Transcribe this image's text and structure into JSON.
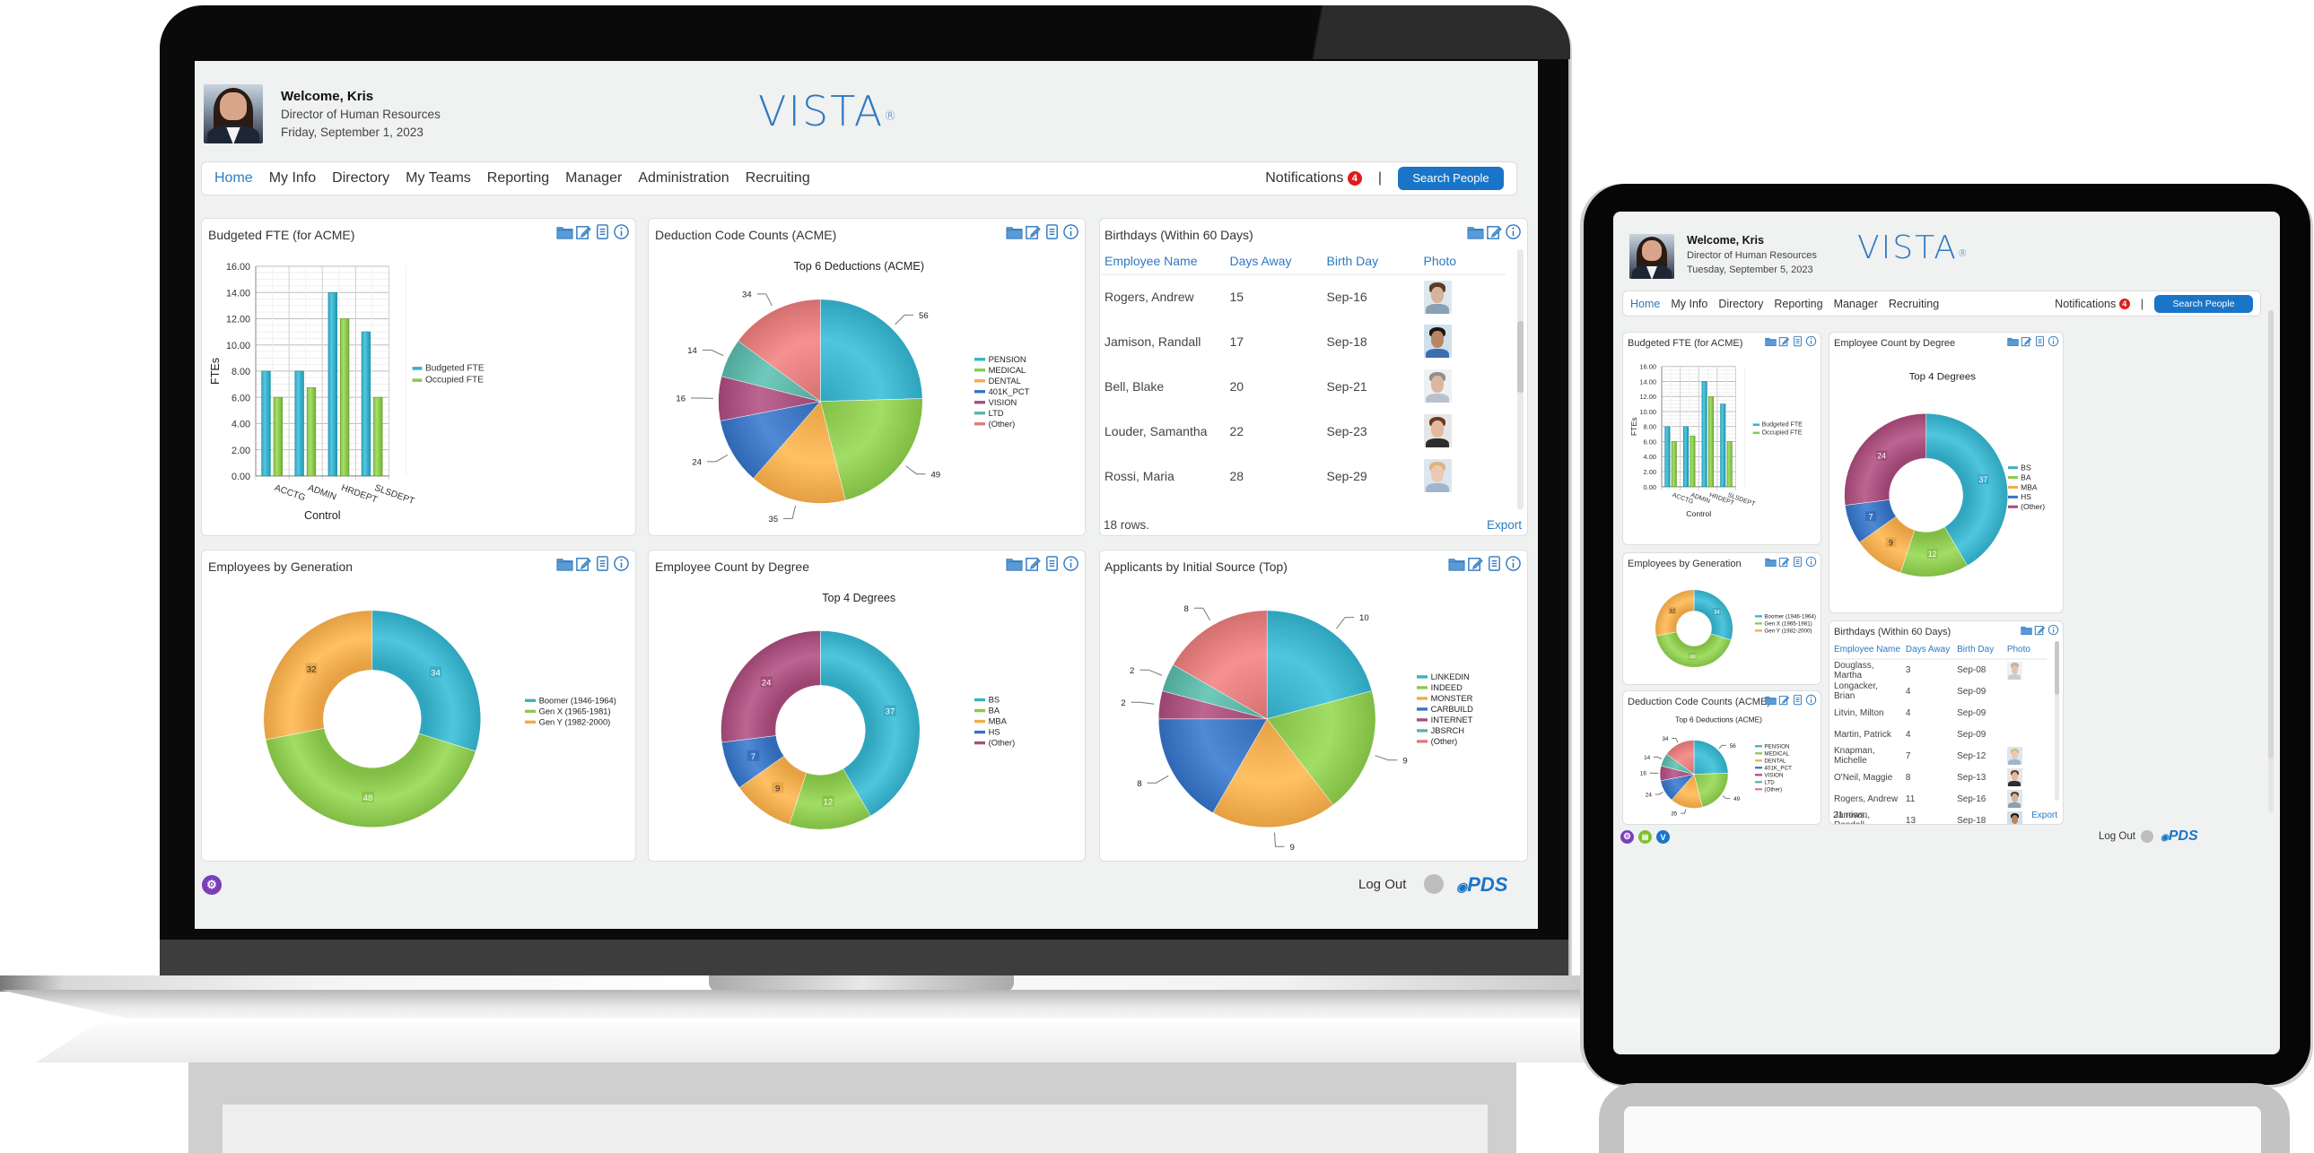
{
  "brand": {
    "logo": "VISTA",
    "registered": "®",
    "vendor_logo": "PDS",
    "accent": "#2f79c1",
    "button_blue": "#1a75c9"
  },
  "palette": {
    "teal": "#3ab0c8",
    "green": "#8cc850",
    "orange": "#f0ab4e",
    "blue": "#3a73c0",
    "plum": "#a64f7c",
    "seafoam": "#5bb3a5",
    "salmon": "#e07b7b"
  },
  "laptop": {
    "user": {
      "welcome": "Welcome, Kris",
      "title": "Director of Human Resources",
      "date": "Friday, September 1, 2023"
    },
    "nav": [
      "Home",
      "My Info",
      "Directory",
      "My Teams",
      "Reporting",
      "Manager",
      "Administration",
      "Recruiting"
    ],
    "active_nav": "Home",
    "notifications_label": "Notifications",
    "notifications_count": "4",
    "pipe": "|",
    "search_button": "Search People",
    "footer": {
      "logout": "Log Out"
    }
  },
  "tablet": {
    "user": {
      "welcome": "Welcome, Kris",
      "title": "Director of Human Resources",
      "date": "Tuesday, September 5, 2023"
    },
    "nav": [
      "Home",
      "My Info",
      "Directory",
      "Reporting",
      "Manager",
      "Recruiting"
    ],
    "active_nav": "Home",
    "notifications_label": "Notifications",
    "notifications_count": "4",
    "pipe": "|",
    "search_button": "Search People",
    "footer": {
      "logout": "Log Out",
      "icon_v": "V"
    }
  },
  "widgets": {
    "fte": {
      "title": "Budgeted FTE (for ACME)"
    },
    "deductions": {
      "title": "Deduction Code Counts (ACME)"
    },
    "birthdays": {
      "title": "Birthdays (Within 60 Days)"
    },
    "generation": {
      "title": "Employees by Generation"
    },
    "degree": {
      "title": "Employee Count by Degree"
    },
    "applicants": {
      "title": "Applicants by Initial Source (Top)"
    }
  },
  "birthdays_laptop": {
    "columns": [
      "Employee Name",
      "Days Away",
      "Birth Day",
      "Photo"
    ],
    "rows": [
      {
        "name": "Rogers, Andrew",
        "days": "15",
        "date": "Sep-16",
        "photo": "man-smiling"
      },
      {
        "name": "Jamison, Randall",
        "days": "17",
        "date": "Sep-18",
        "photo": "man-beard"
      },
      {
        "name": "Bell, Blake",
        "days": "20",
        "date": "Sep-21",
        "photo": "man-grey-hair"
      },
      {
        "name": "Louder, Samantha",
        "days": "22",
        "date": "Sep-23",
        "photo": "woman-brown-hair"
      },
      {
        "name": "Rossi, Maria",
        "days": "28",
        "date": "Sep-29",
        "photo": "woman-blonde"
      }
    ],
    "row_count": "18 rows.",
    "export": "Export"
  },
  "birthdays_tablet": {
    "columns": [
      "Employee Name",
      "Days Away",
      "Birth Day",
      "Photo"
    ],
    "rows": [
      {
        "name": "Douglass, Martha",
        "days": "3",
        "date": "Sep-08",
        "photo": "woman-grey-hair"
      },
      {
        "name": "Longacker, Brian",
        "days": "4",
        "date": "Sep-09",
        "photo": ""
      },
      {
        "name": "Litvin, Milton",
        "days": "4",
        "date": "Sep-09",
        "photo": ""
      },
      {
        "name": "Martin, Patrick",
        "days": "4",
        "date": "Sep-09",
        "photo": ""
      },
      {
        "name": "Knapman, Michelle",
        "days": "7",
        "date": "Sep-12",
        "photo": "woman-blonde"
      },
      {
        "name": "O'Neil, Maggie",
        "days": "8",
        "date": "Sep-13",
        "photo": "woman-brown-hair"
      },
      {
        "name": "Rogers, Andrew",
        "days": "11",
        "date": "Sep-16",
        "photo": "man-smiling"
      },
      {
        "name": "Jamison, Randall",
        "days": "13",
        "date": "Sep-18",
        "photo": "man-beard"
      }
    ],
    "row_count": "21 rows.",
    "export": "Export"
  },
  "chart_data": [
    {
      "id": "fte",
      "type": "bar",
      "title": "Budgeted FTE (for ACME)",
      "xlabel": "Control",
      "ylabel": "FTEs",
      "categories": [
        "ACCTG",
        "ADMIN",
        "HRDEPT",
        "SLSDEPT"
      ],
      "series": [
        {
          "name": "Budgeted FTE",
          "color": "#3ab0c8",
          "values": [
            8,
            8,
            14,
            11
          ]
        },
        {
          "name": "Occupied FTE",
          "color": "#8cc850",
          "values": [
            6,
            6.75,
            12,
            6
          ]
        }
      ],
      "ylim": [
        0,
        16
      ],
      "yticks": [
        "0.00",
        "2.00",
        "4.00",
        "6.00",
        "8.00",
        "10.00",
        "12.00",
        "14.00",
        "16.00"
      ],
      "grid": true,
      "legend": "right"
    },
    {
      "id": "deductions",
      "type": "pie",
      "title": "Top 6 Deductions (ACME)",
      "labels": [
        "PENSION",
        "MEDICAL",
        "DENTAL",
        "401K_PCT",
        "VISION",
        "LTD",
        "(Other)"
      ],
      "values": [
        56,
        49,
        35,
        24,
        16,
        14,
        34
      ],
      "colors": [
        "#3ab0c8",
        "#8cc850",
        "#f0ab4e",
        "#3a73c0",
        "#a64f7c",
        "#5bb3a5",
        "#e07b7b"
      ],
      "legend": "right",
      "labels_outside": true
    },
    {
      "id": "generation",
      "type": "pie",
      "donut": true,
      "title": "",
      "labels": [
        "Boomer (1946-1964)",
        "Gen X (1965-1981)",
        "Gen Y (1982-2000)"
      ],
      "values": [
        34,
        48,
        32
      ],
      "colors": [
        "#3ab0c8",
        "#8cc850",
        "#f0ab4e"
      ],
      "legend": "right"
    },
    {
      "id": "degree",
      "type": "pie",
      "donut": true,
      "title": "Top 4 Degrees",
      "labels": [
        "BS",
        "BA",
        "MBA",
        "HS",
        "(Other)"
      ],
      "values": [
        37,
        12,
        9,
        7,
        24
      ],
      "colors": [
        "#3ab0c8",
        "#8cc850",
        "#f0ab4e",
        "#3a73c0",
        "#a64f7c"
      ],
      "legend": "right"
    },
    {
      "id": "applicants",
      "type": "pie",
      "title": "",
      "labels": [
        "LINKEDIN",
        "INDEED",
        "MONSTER",
        "CARBUILD",
        "INTERNET",
        "JBSRCH",
        "(Other)"
      ],
      "values": [
        10,
        9,
        9,
        8,
        2,
        2,
        8
      ],
      "colors": [
        "#3ab0c8",
        "#8cc850",
        "#f0ab4e",
        "#3a73c0",
        "#a64f7c",
        "#5bb3a5",
        "#e07b7b"
      ],
      "legend": "right",
      "labels_outside": true
    }
  ]
}
